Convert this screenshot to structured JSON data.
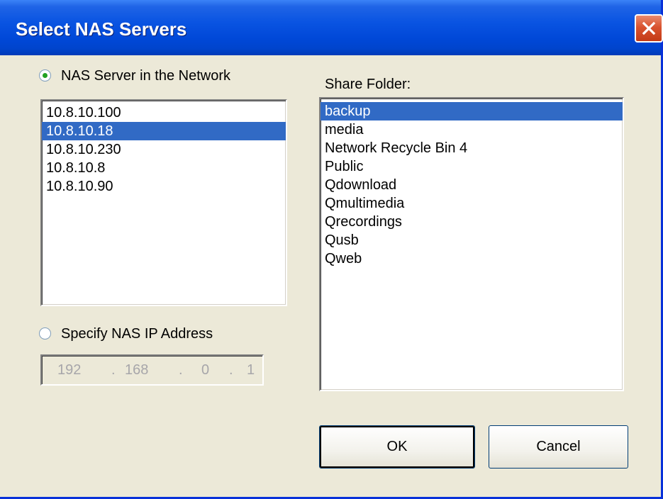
{
  "window": {
    "title": "Select NAS Servers"
  },
  "network_option": {
    "label": "NAS Server in the Network",
    "checked": true
  },
  "servers": [
    {
      "label": "10.8.10.100",
      "selected": false
    },
    {
      "label": "10.8.10.18",
      "selected": true
    },
    {
      "label": "10.8.10.230",
      "selected": false
    },
    {
      "label": "10.8.10.8",
      "selected": false
    },
    {
      "label": "10.8.10.90",
      "selected": false
    }
  ],
  "specify_option": {
    "label": "Specify NAS IP Address",
    "checked": false
  },
  "ip_address": {
    "octet1": "192",
    "octet2": "168",
    "octet3": "0",
    "octet4": "1",
    "separator": "."
  },
  "share_folder": {
    "label": "Share Folder:",
    "items": [
      {
        "label": "backup",
        "selected": true
      },
      {
        "label": "media",
        "selected": false
      },
      {
        "label": "Network Recycle Bin 4",
        "selected": false
      },
      {
        "label": "Public",
        "selected": false
      },
      {
        "label": "Qdownload",
        "selected": false
      },
      {
        "label": "Qmultimedia",
        "selected": false
      },
      {
        "label": "Qrecordings",
        "selected": false
      },
      {
        "label": "Qusb",
        "selected": false
      },
      {
        "label": "Qweb",
        "selected": false
      }
    ]
  },
  "buttons": {
    "ok_label": "OK",
    "cancel_label": "Cancel"
  },
  "colors": {
    "titlebar": "#0A54E2",
    "selection": "#316AC5",
    "dialog_bg": "#ECE9D8",
    "close_button": "#D9532F"
  },
  "icons": {
    "close": "close-icon"
  }
}
